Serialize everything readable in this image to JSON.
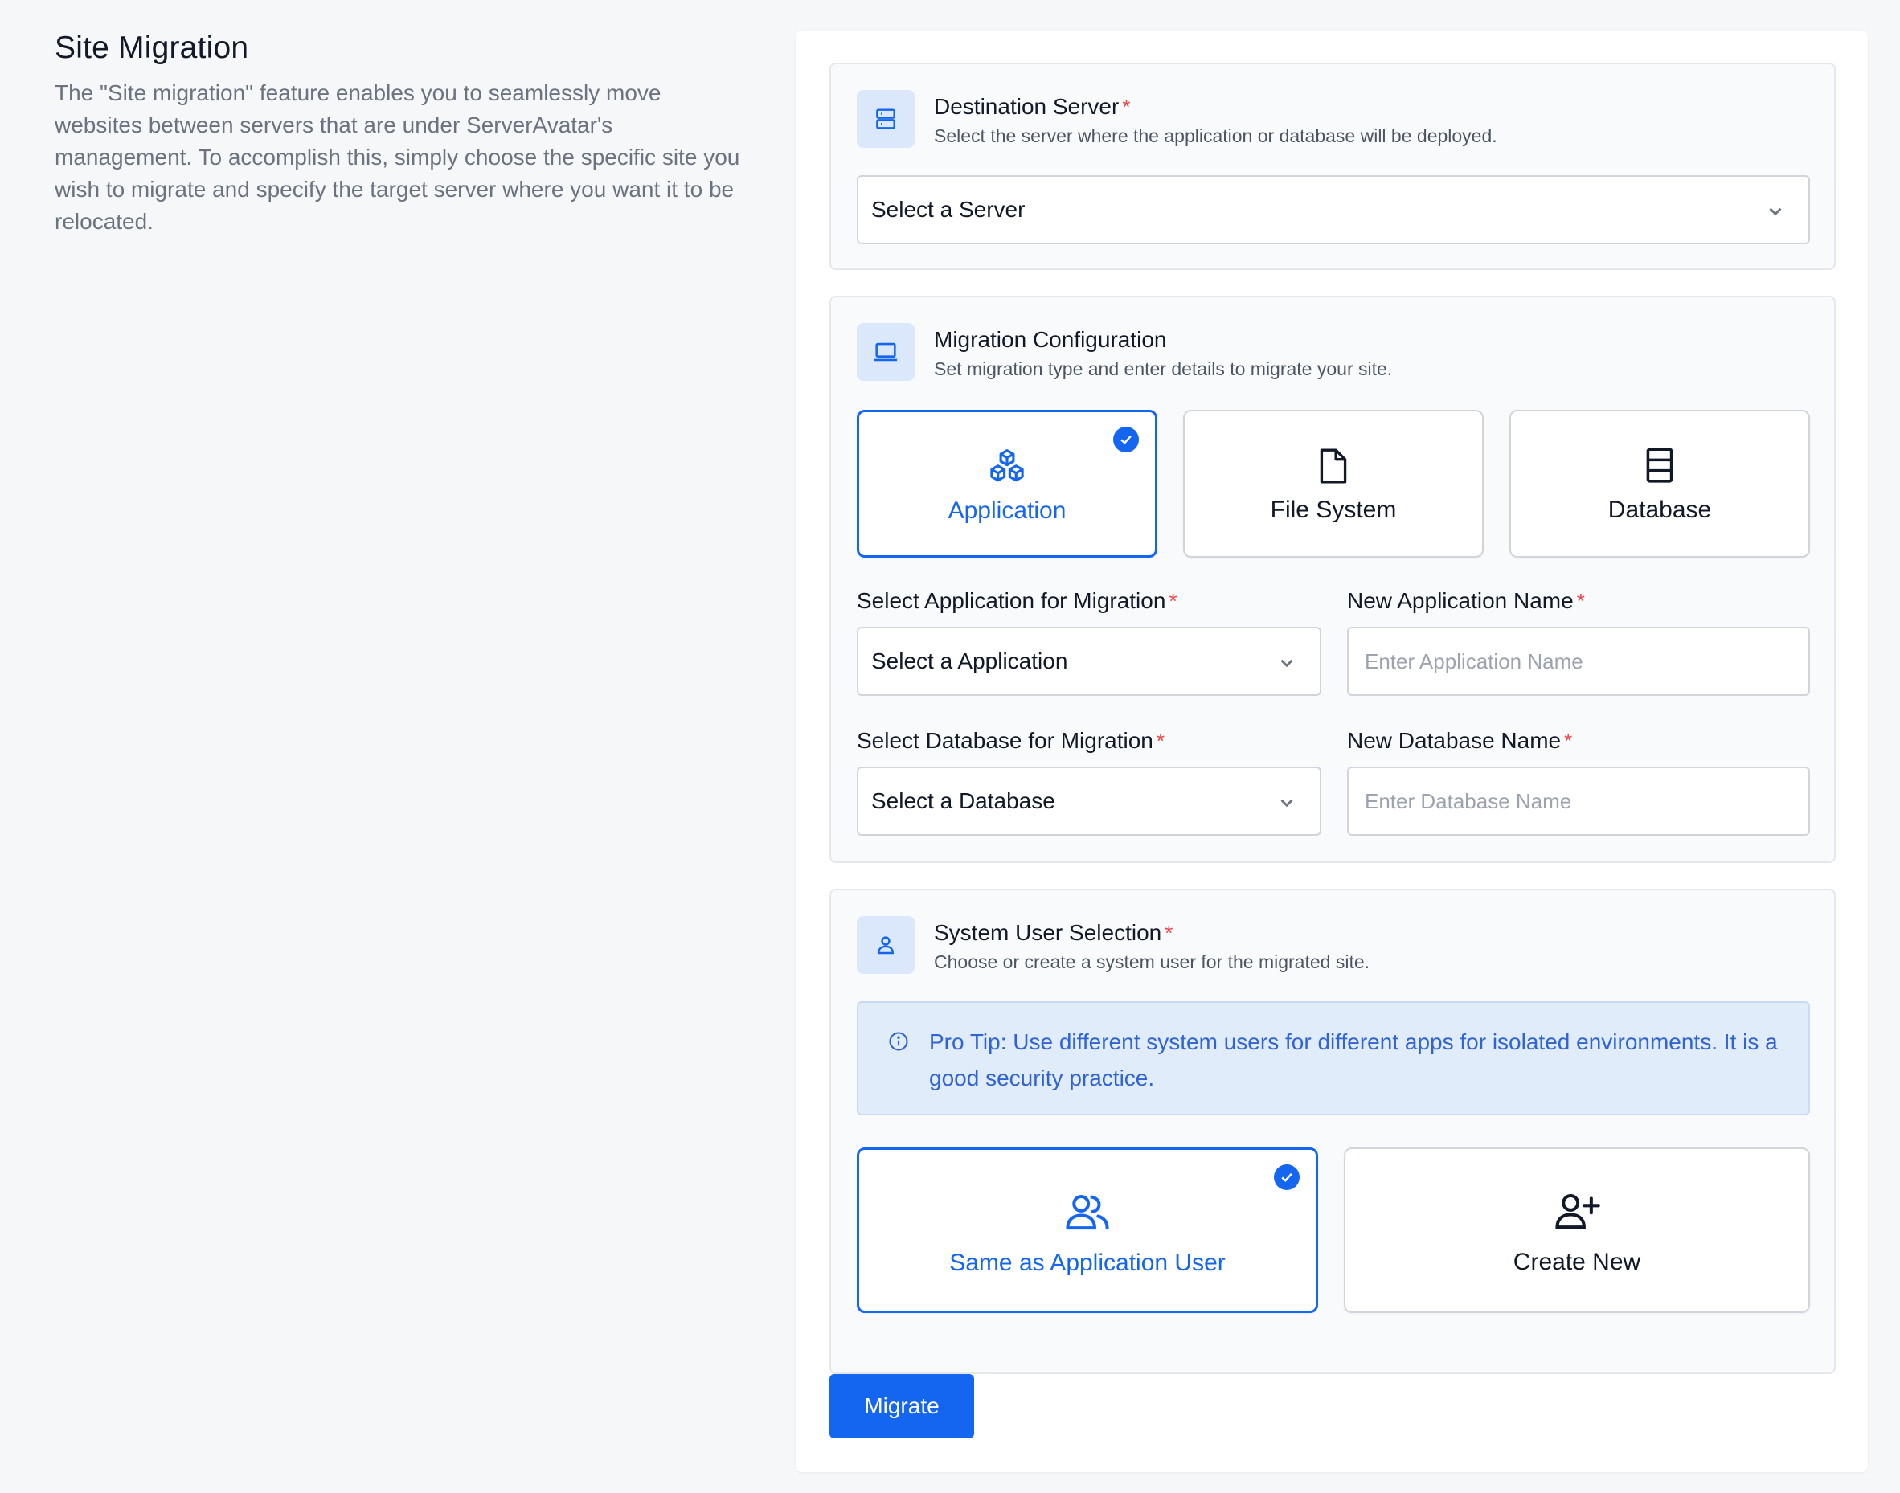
{
  "intro": {
    "title": "Site Migration",
    "description": "The \"Site migration\" feature enables you to seamlessly move websites between servers that are under ServerAvatar's management. To accomplish this, simply choose the specific site you wish to migrate and specify the target server where you want it to be relocated."
  },
  "destination": {
    "title": "Destination Server",
    "required": "*",
    "description": "Select the server where the application or database will be deployed.",
    "select_value": "Select a Server",
    "icon": "server-icon"
  },
  "migration": {
    "title": "Migration Configuration",
    "description": "Set migration type and enter details to migrate your site.",
    "icon": "laptop-icon",
    "types": [
      {
        "label": "Application",
        "icon": "cubes-icon",
        "selected": true
      },
      {
        "label": "File System",
        "icon": "file-icon",
        "selected": false
      },
      {
        "label": "Database",
        "icon": "database-icon",
        "selected": false
      }
    ],
    "app_select_label": "Select Application for Migration",
    "app_select_value": "Select a Application",
    "app_name_label": "New Application Name",
    "app_name_placeholder": "Enter Application Name",
    "db_select_label": "Select Database for Migration",
    "db_select_value": "Select a Database",
    "db_name_label": "New Database Name",
    "db_name_placeholder": "Enter Database Name",
    "required": "*"
  },
  "system_user": {
    "title": "System User Selection",
    "required": "*",
    "description": "Choose or create a system user for the migrated site.",
    "icon": "user-icon",
    "tip": "Pro Tip: Use different system users for different apps for isolated environments. It is a good security practice.",
    "options": [
      {
        "label": "Same as Application User",
        "icon": "users-icon",
        "selected": true
      },
      {
        "label": "Create New",
        "icon": "user-plus-icon",
        "selected": false
      }
    ]
  },
  "actions": {
    "migrate_label": "Migrate"
  },
  "colors": {
    "accent": "#1466f0",
    "required": "#ef4444",
    "tip_bg": "#e1ecfb"
  }
}
